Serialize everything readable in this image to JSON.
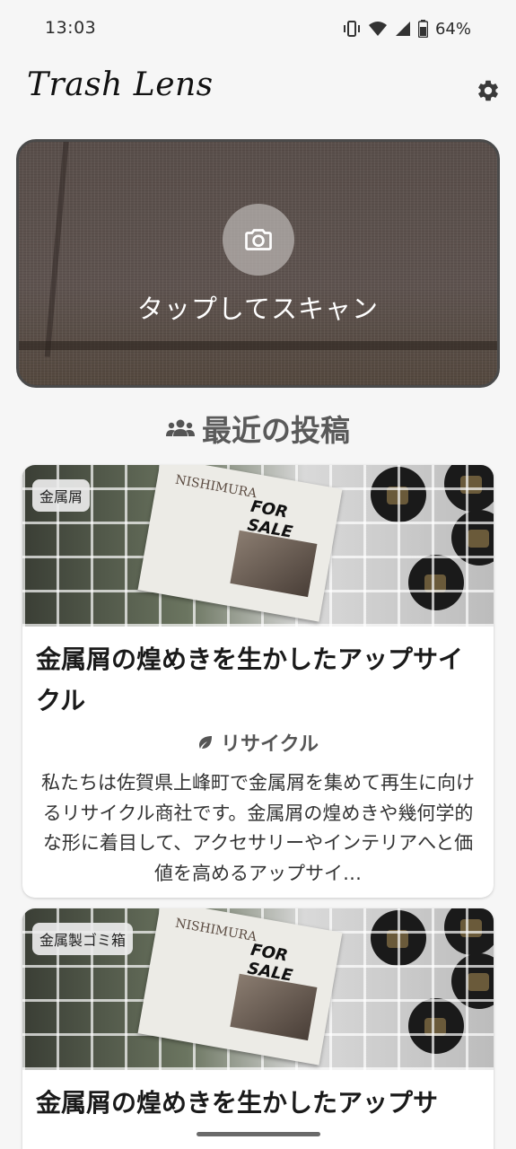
{
  "status_bar": {
    "time": "13:03",
    "battery": "64%"
  },
  "app": {
    "title": "Trash Lens"
  },
  "scan": {
    "label": "タップしてスキャン"
  },
  "recent": {
    "heading": "最近の投稿"
  },
  "posts": [
    {
      "tag": "金属屑",
      "title": "金属屑の煌めきを生かしたアップサイクル",
      "category": "リサイクル",
      "description": "私たちは佐賀県上峰町で金属屑を集めて再生に向けるリサイクル商社です。金属屑の煌めきや幾何学的な形に着目して、アクセサリーやインテリアへと価値を高めるアップサイ…",
      "image_text": {
        "brand": "NISHIMURA",
        "sign": "FOR SALE"
      }
    },
    {
      "tag": "金属製ゴミ箱",
      "title": "金属屑の煌めきを生かしたアップサ",
      "image_text": {
        "brand": "NISHIMURA",
        "sign": "FOR SALE"
      }
    }
  ]
}
